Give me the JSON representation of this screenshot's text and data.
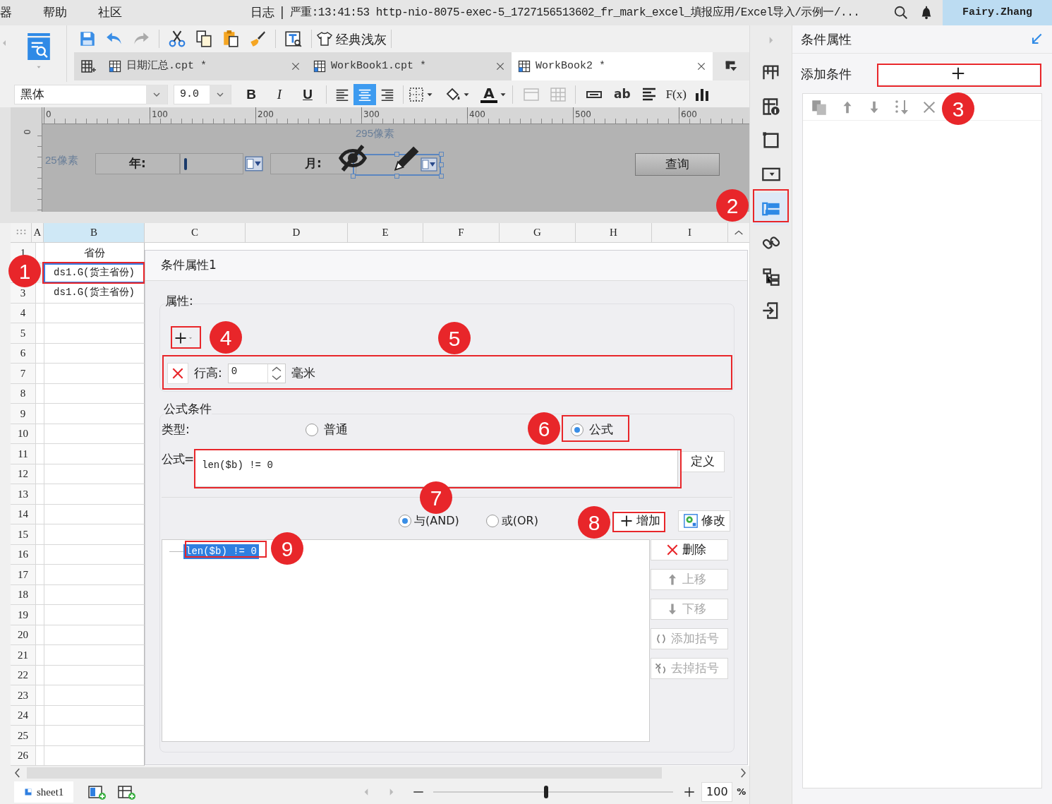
{
  "menu_bar": {
    "items": [
      "器",
      "帮助",
      "社区"
    ],
    "log": "日志",
    "separator": "|",
    "status": "严重:13:41:53 http-nio-8075-exec-5_1727156513602_fr_mark_excel_填报应用/Excel导入/示例一/...",
    "user": "Fairy.Zhang"
  },
  "toolbar": {
    "theme_label": "经典浅灰"
  },
  "tabs": [
    {
      "label": "日期汇总.cpt *",
      "selected": false
    },
    {
      "label": "WorkBook1.cpt *",
      "selected": false
    },
    {
      "label": "WorkBook2 *",
      "selected": true
    }
  ],
  "format_bar": {
    "font": "黑体",
    "size": "9.0",
    "style_buttons": [
      {
        "label": "B",
        "kind": "bold"
      },
      {
        "label": "I",
        "kind": "italic"
      },
      {
        "label": "U",
        "kind": "underline"
      }
    ],
    "align_buttons": [
      {
        "kind": "left",
        "selected": false
      },
      {
        "kind": "center",
        "selected": true
      },
      {
        "kind": "right",
        "selected": false
      }
    ],
    "font_color_label": "A",
    "text_tool": "ab",
    "formula_tool": "F(x)"
  },
  "designer": {
    "ruler_ticks": [
      "0",
      "100",
      "200",
      "300",
      "400",
      "500",
      "600"
    ],
    "vertical_tick": "0",
    "width_hint": "295像素",
    "height_hint": "25像素",
    "year_label": "年:",
    "month_label": "月:",
    "query_button": "查询"
  },
  "sheet": {
    "columns": [
      {
        "label": "A",
        "selected": false
      },
      {
        "label": "B",
        "selected": true
      },
      {
        "label": "C",
        "selected": false
      },
      {
        "label": "D",
        "selected": false
      },
      {
        "label": "E",
        "selected": false
      },
      {
        "label": "F",
        "selected": false
      },
      {
        "label": "G",
        "selected": false
      },
      {
        "label": "H",
        "selected": false
      },
      {
        "label": "I",
        "selected": false
      }
    ],
    "rows": [
      {
        "number": "1",
        "cell": "省份",
        "selected": false
      },
      {
        "cell": "ds1.G(货主省份)",
        "selected": true
      },
      {
        "number": "3",
        "cell": "ds1.G(货主省份)",
        "selected": false
      },
      {
        "number": "4"
      },
      {
        "number": "5"
      },
      {
        "number": "6"
      },
      {
        "number": "7"
      },
      {
        "number": "8"
      },
      {
        "number": "9"
      },
      {
        "number": "10"
      },
      {
        "number": "11"
      },
      {
        "number": "12"
      },
      {
        "number": "13"
      },
      {
        "number": "14"
      },
      {
        "number": "15"
      },
      {
        "number": "16"
      },
      {
        "number": "17"
      },
      {
        "number": "18"
      },
      {
        "number": "19"
      },
      {
        "number": "20"
      },
      {
        "number": "21"
      },
      {
        "number": "22"
      },
      {
        "number": "23"
      },
      {
        "number": "24"
      },
      {
        "number": "25"
      },
      {
        "number": "26"
      }
    ]
  },
  "dialog": {
    "title": "条件属性1",
    "properties_label": "属性:",
    "property": {
      "label": "行高:",
      "value": "0",
      "unit": "毫米"
    },
    "formula_section": "公式条件",
    "type_label": "类型:",
    "types": [
      {
        "label": "普通",
        "selected": false
      },
      {
        "label": "公式",
        "selected": true
      }
    ],
    "formula_label": "公式=",
    "formula": "len($b) != 0",
    "define_button": "定义",
    "joins": [
      {
        "label": "与(AND)",
        "selected": true
      },
      {
        "label": "或(OR)",
        "selected": false
      }
    ],
    "add_button": "增加",
    "modify_button": "修改",
    "conditions": [
      {
        "text": "len($b) != 0",
        "selected": true
      }
    ],
    "side_buttons": [
      {
        "kind": "delete",
        "label": "删除",
        "disabled": false
      },
      {
        "kind": "up",
        "label": "上移",
        "disabled": true
      },
      {
        "kind": "down",
        "label": "下移",
        "disabled": true
      },
      {
        "kind": "add_paren",
        "label": "添加括号",
        "disabled": true
      },
      {
        "kind": "remove_paren",
        "label": "去掉括号",
        "disabled": true
      }
    ]
  },
  "side_tools": [
    {
      "kind": "cell",
      "selected": false
    },
    {
      "kind": "cell_info",
      "selected": false
    },
    {
      "kind": "border",
      "selected": false
    },
    {
      "kind": "dropdown",
      "selected": false
    },
    {
      "kind": "condition",
      "selected": true
    },
    {
      "kind": "link",
      "selected": false
    },
    {
      "kind": "tree",
      "selected": false
    },
    {
      "kind": "import",
      "selected": false
    }
  ],
  "right_panel": {
    "title": "条件属性",
    "add_label": "添加条件"
  },
  "sheet_tabs": [
    {
      "label": "sheet1",
      "selected": true
    }
  ],
  "zoom": {
    "value": "100",
    "unit": "%",
    "level": 0.47
  },
  "annotations": [
    {
      "number": "1"
    },
    {
      "number": "2"
    },
    {
      "number": "3"
    },
    {
      "number": "4"
    },
    {
      "number": "5"
    },
    {
      "number": "6"
    },
    {
      "number": "7"
    },
    {
      "number": "8"
    },
    {
      "number": "9"
    }
  ]
}
